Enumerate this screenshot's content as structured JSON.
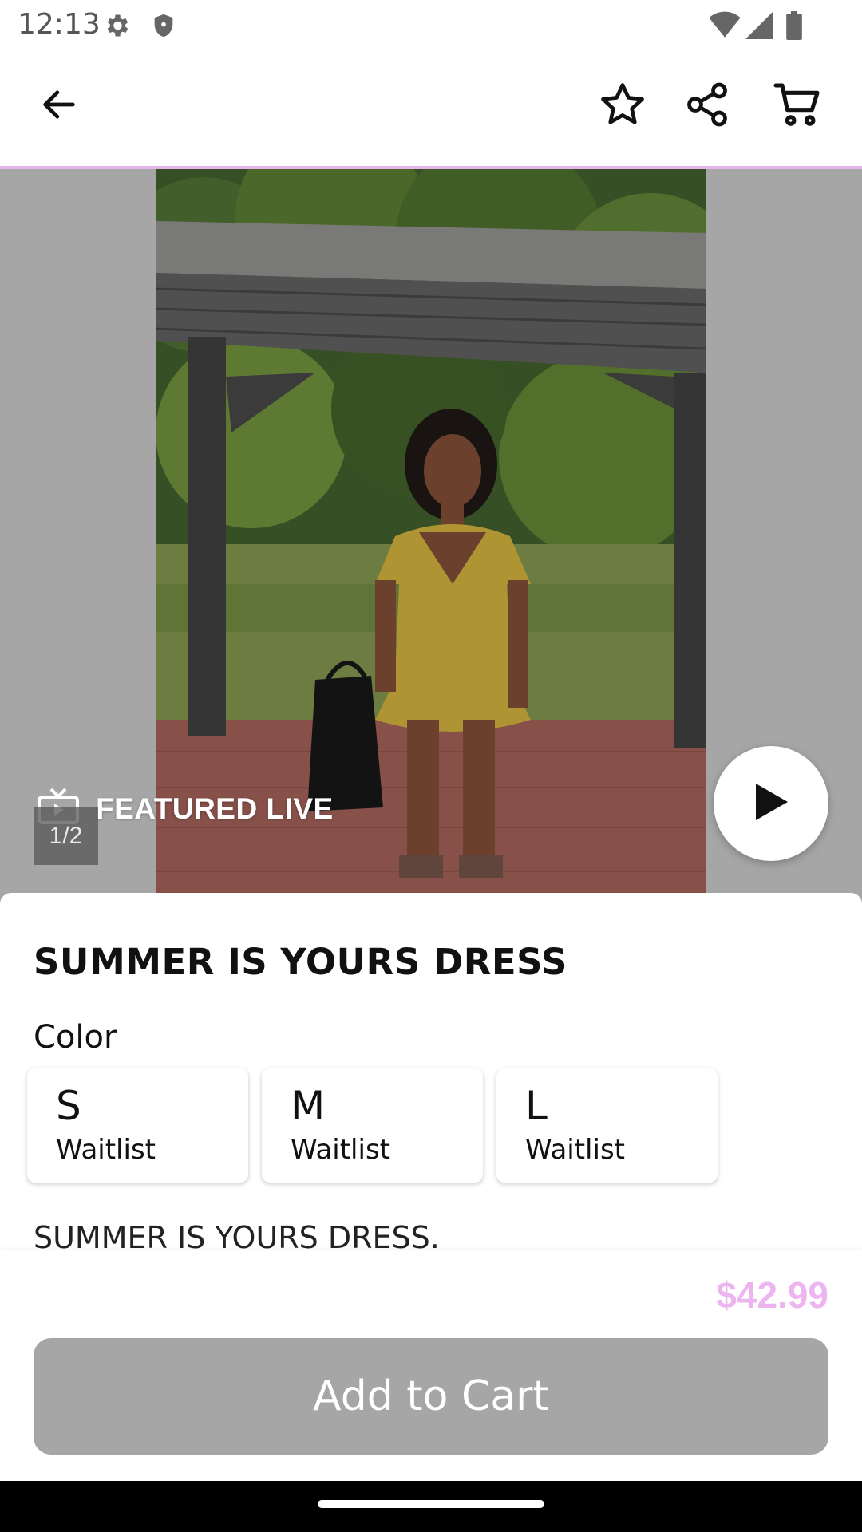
{
  "status_bar": {
    "time": "12:13",
    "icons": [
      "gear-icon",
      "shield-icon",
      "wifi-icon",
      "signal-icon",
      "battery-icon"
    ]
  },
  "toolbar": {
    "icons": [
      "back-arrow-icon",
      "star-icon",
      "share-icon",
      "cart-icon"
    ],
    "accent_color": "#e5b6ea"
  },
  "media": {
    "featured_label": "FEATURED LIVE",
    "image_counter": "1/2",
    "featured_icon": "tv-icon",
    "play_icon": "play-icon"
  },
  "product": {
    "title": "SUMMER IS YOURS DRESS",
    "option_label": "Color",
    "sizes": [
      {
        "name": "S",
        "status": "Waitlist"
      },
      {
        "name": "M",
        "status": "Waitlist"
      },
      {
        "name": "L",
        "status": "Waitlist"
      }
    ],
    "description": "SUMMER IS YOURS DRESS."
  },
  "footer": {
    "price": "$42.99",
    "price_color": "#ecb5f0",
    "add_to_cart_label": "Add to Cart"
  }
}
